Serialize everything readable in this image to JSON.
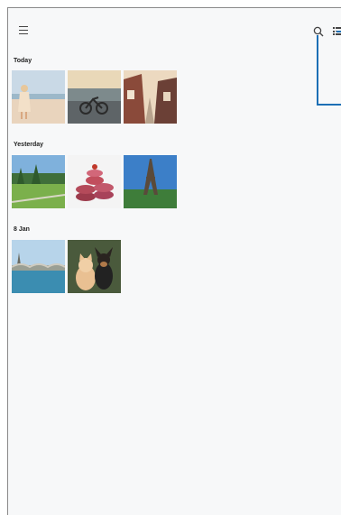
{
  "sections": [
    {
      "label": "Today"
    },
    {
      "label": "Yesterday"
    },
    {
      "label": "8 Jan"
    }
  ],
  "photos": {
    "today": [
      "beach-girl-photo",
      "bike-on-beach-photo",
      "village-street-photo"
    ],
    "yesterday": [
      "green-park-photo",
      "macarons-photo",
      "eiffel-tower-photo"
    ],
    "jan8": [
      "river-bridge-photo",
      "cat-and-dog-photo"
    ]
  },
  "colors": {
    "accent": "#1c6fb5",
    "background": "#f7f8f9"
  },
  "icons": [
    "menu-icon",
    "search-icon",
    "list-view-icon"
  ]
}
